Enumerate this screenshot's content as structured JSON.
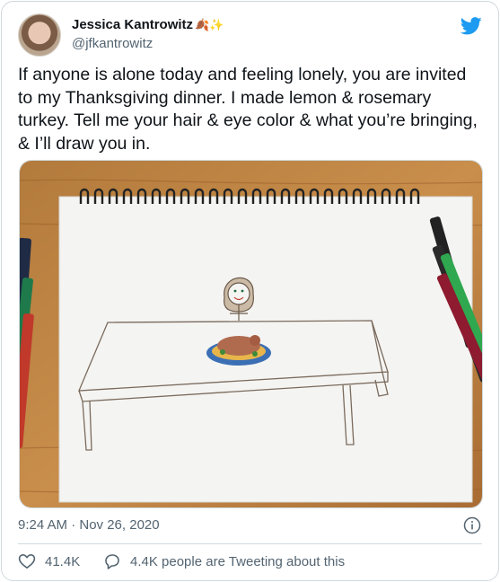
{
  "author": {
    "display_name": "Jessica Kantrowitz",
    "name_emoji": "🍂✨",
    "handle": "@jfkantrowitz"
  },
  "tweet": {
    "text": "If anyone is alone today and feeling lonely, you are invited to my Thanksgiving dinner. I made lemon & rosemary turkey. Tell me your hair & eye color & what you’re bringing, & I’ll draw you in."
  },
  "meta": {
    "timestamp": "9:24 AM · Nov 26, 2020"
  },
  "actions": {
    "likes": "41.4K",
    "replies_label": "4.4K people are Tweeting about this"
  },
  "icons": {
    "brand": "twitter-bird-icon",
    "info": "info-icon",
    "like": "heart-icon",
    "reply": "comment-icon"
  },
  "colors": {
    "brand_blue": "#1d9bf0",
    "text_primary": "#0f1419",
    "text_secondary": "#536471",
    "border": "#cfd9de"
  }
}
